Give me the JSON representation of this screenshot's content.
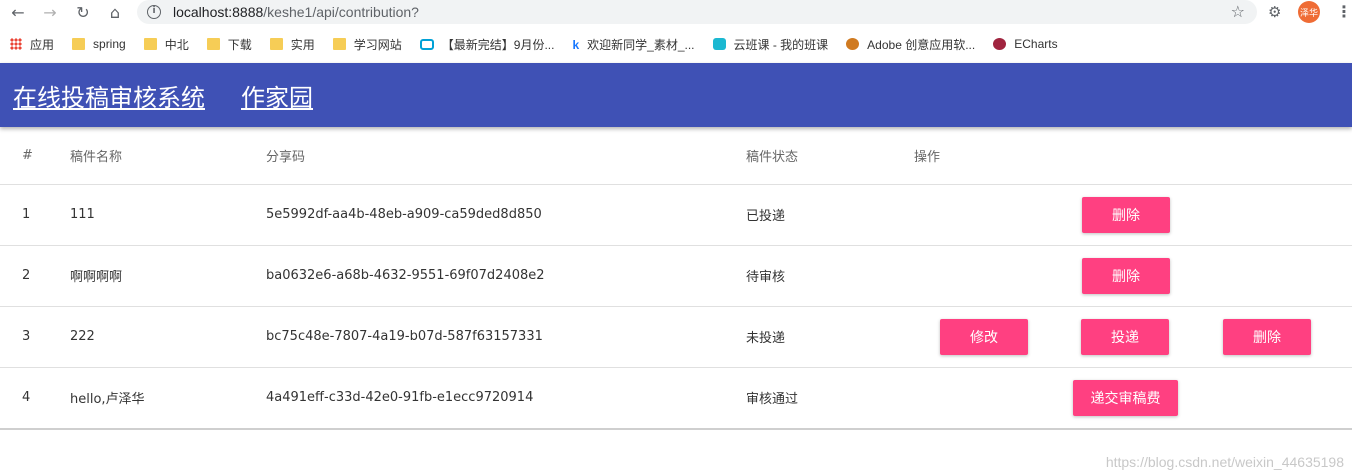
{
  "browser": {
    "url_host": "localhost:8888",
    "url_path": "/keshe1/api/contribution?",
    "avatar_text": "泽华",
    "bookmarks": [
      {
        "label": "应用",
        "icon": "apps-grid-icon"
      },
      {
        "label": "spring",
        "icon": "folder-icon"
      },
      {
        "label": "中北",
        "icon": "folder-icon"
      },
      {
        "label": "下载",
        "icon": "folder-icon"
      },
      {
        "label": "实用",
        "icon": "folder-icon"
      },
      {
        "label": "学习网站",
        "icon": "folder-icon"
      },
      {
        "label": "【最新完结】9月份...",
        "icon": "bilibili-icon"
      },
      {
        "label": "欢迎新同学_素材_...",
        "icon": "kc-icon"
      },
      {
        "label": "云班课 - 我的班课",
        "icon": "cloud-class-icon"
      },
      {
        "label": "Adobe 创意应用软...",
        "icon": "adobe-icon"
      },
      {
        "label": "ECharts",
        "icon": "echarts-icon"
      }
    ]
  },
  "header": {
    "title": "在线投稿审核系统",
    "nav_link": "作家园",
    "color": "#3f51b5"
  },
  "table": {
    "columns": [
      "#",
      "稿件名称",
      "分享码",
      "稿件状态",
      "操作"
    ],
    "rows": [
      {
        "idx": "1",
        "name": "111",
        "code": "5e5992df-aa4b-48eb-a909-ca59ded8d850",
        "status": "已投递"
      },
      {
        "idx": "2",
        "name": "啊啊啊啊",
        "code": "ba0632e6-a68b-4632-9551-69f07d2408e2",
        "status": "待审核"
      },
      {
        "idx": "3",
        "name": "222",
        "code": "bc75c48e-7807-4a19-b07d-587f63157331",
        "status": "未投递"
      },
      {
        "idx": "4",
        "name": "hello,卢泽华",
        "code": "4a491eff-c33d-42e0-91fb-e1ecc9720914",
        "status": "审核通过"
      }
    ],
    "buttons": {
      "delete": "删除",
      "edit": "修改",
      "submit": "投递",
      "fee": "递交审稿费"
    },
    "button_color": "#ff4081"
  },
  "watermark": "https://blog.csdn.net/weixin_44635198"
}
